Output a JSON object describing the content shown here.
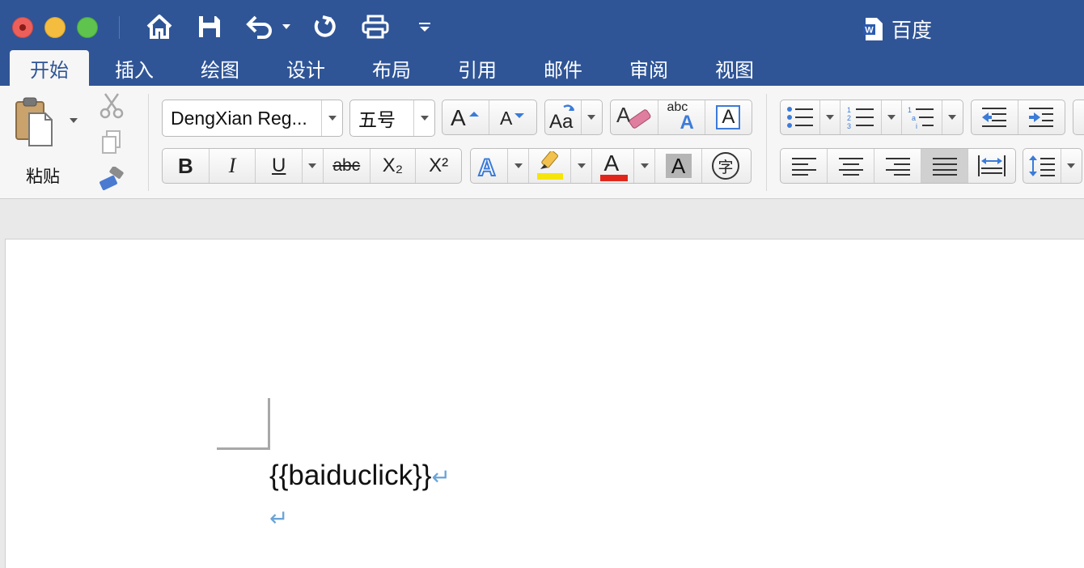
{
  "window": {
    "title": "百度"
  },
  "tabs": [
    {
      "label": "开始",
      "active": true
    },
    {
      "label": "插入"
    },
    {
      "label": "绘图"
    },
    {
      "label": "设计"
    },
    {
      "label": "布局"
    },
    {
      "label": "引用"
    },
    {
      "label": "邮件"
    },
    {
      "label": "审阅"
    },
    {
      "label": "视图"
    }
  ],
  "ribbon": {
    "paste_label": "粘贴",
    "font_name": "DengXian Reg...",
    "font_size": "五号",
    "bold": "B",
    "italic": "I",
    "underline": "U",
    "strike": "abc",
    "subscript": "X₂",
    "superscript": "X²",
    "phonetic": "字",
    "spellcheck": "abc",
    "highlight_color": "#f5e50c",
    "font_color": "#e0261b"
  },
  "document": {
    "line1": "{{baiduclick}}",
    "paragraph_mark": "↵"
  },
  "colors": {
    "accent": "#2f5597"
  }
}
